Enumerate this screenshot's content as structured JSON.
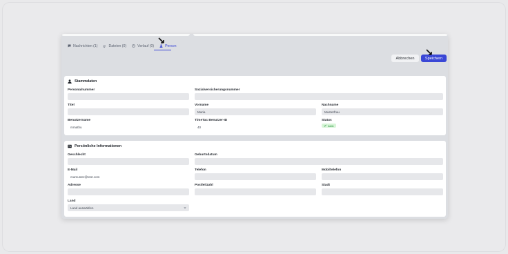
{
  "tabs": [
    {
      "label": "Nachrichten (1)",
      "icon": "chat-icon"
    },
    {
      "label": "Dateien (0)",
      "icon": "paperclip-icon"
    },
    {
      "label": "Verlauf (0)",
      "icon": "clock-icon"
    },
    {
      "label": "Person",
      "icon": "user-icon",
      "active": true
    }
  ],
  "actions": {
    "cancel": "Abbrechen",
    "save": "Speichern"
  },
  "stammdaten": {
    "title": "Stammdaten",
    "personalnummer": {
      "label": "Personalnummer",
      "value": ""
    },
    "sozialversicherungsnummer": {
      "label": "Sozialversicherungsnummer",
      "value": ""
    },
    "titel": {
      "label": "Titel",
      "value": ""
    },
    "vorname": {
      "label": "Vorname",
      "value": "Maria"
    },
    "nachname": {
      "label": "Nachname",
      "value": "Musterfrau"
    },
    "benutzername": {
      "label": "Benutzername",
      "value": "mmathu"
    },
    "timetac_id": {
      "label": "TimeTac Benutzer-ID",
      "value": "40"
    },
    "status": {
      "label": "Status",
      "value": "Aktiv"
    }
  },
  "persoenlich": {
    "title": "Persönliche Informationen",
    "geschlecht": {
      "label": "Geschlecht",
      "value": ""
    },
    "geburtsdatum": {
      "label": "Geburtsdatum",
      "value": ""
    },
    "email": {
      "label": "E-Mail",
      "value": "mamuster@test.com"
    },
    "telefon": {
      "label": "Telefon",
      "value": ""
    },
    "mobiltelefon": {
      "label": "Mobiltelefon",
      "value": ""
    },
    "adresse": {
      "label": "Adresse",
      "value": ""
    },
    "postleitzahl": {
      "label": "Postleitzahl",
      "value": ""
    },
    "stadt": {
      "label": "Stadt",
      "value": ""
    },
    "land": {
      "label": "Land",
      "value": "Land auswählen"
    }
  },
  "colors": {
    "accent": "#3a47d6",
    "status_bg": "#d8f5d8",
    "status_text": "#23933a"
  }
}
